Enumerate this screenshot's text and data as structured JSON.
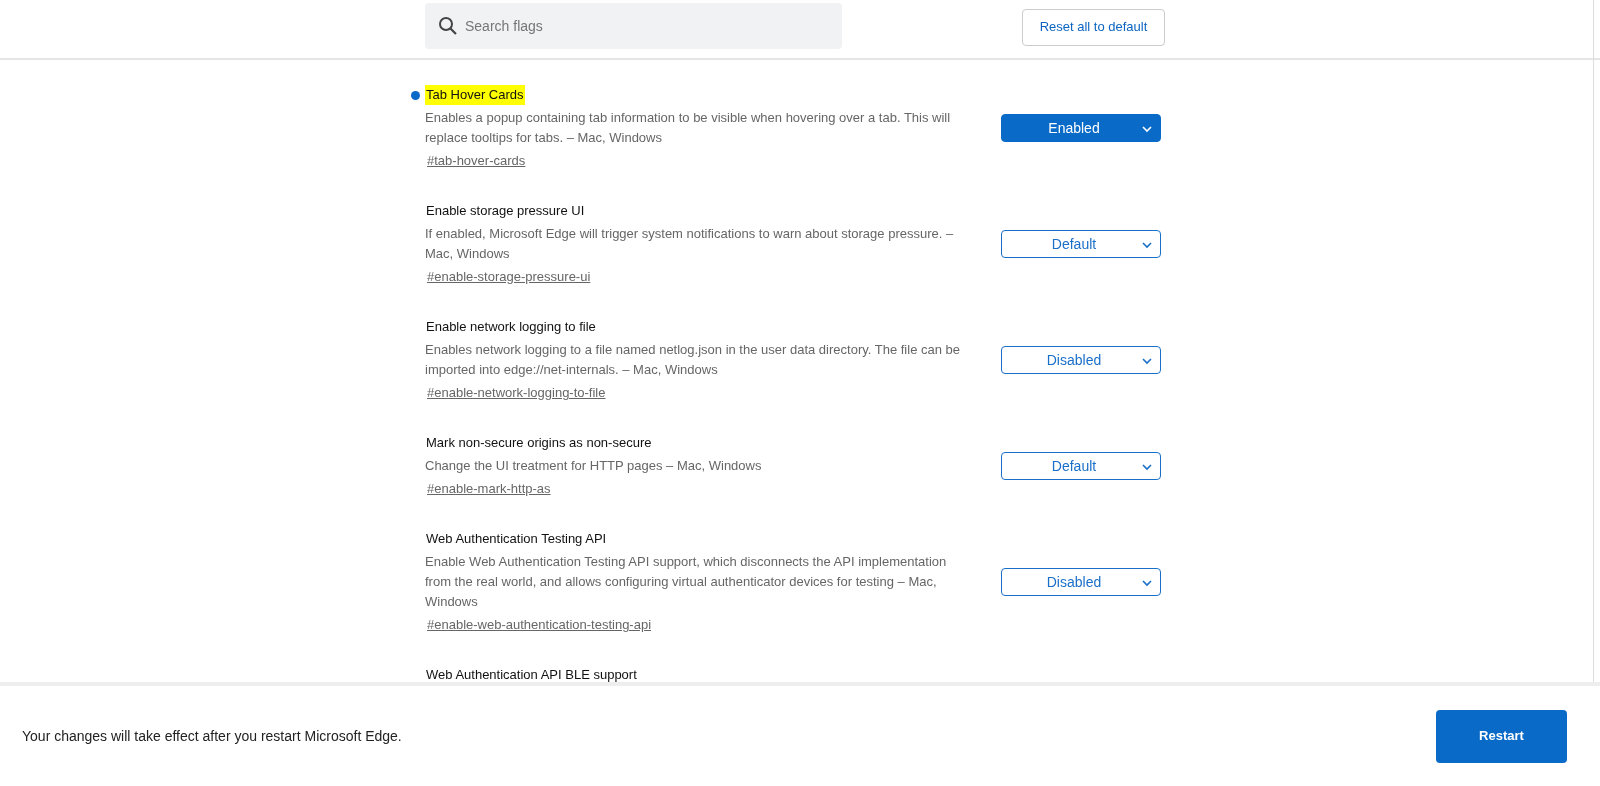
{
  "search": {
    "placeholder": "Search flags"
  },
  "reset_button": "Reset all to default",
  "flags": [
    {
      "title": "Tab Hover Cards",
      "highlighted": true,
      "modified": true,
      "description": "Enables a popup containing tab information to be visible when hovering over a tab. This will replace tooltips for tabs. – Mac, Windows",
      "link": "#tab-hover-cards",
      "value": "Enabled"
    },
    {
      "title": "Enable storage pressure UI",
      "highlighted": false,
      "modified": false,
      "description": "If enabled, Microsoft Edge will trigger system notifications to warn about storage pressure. – Mac, Windows",
      "link": "#enable-storage-pressure-ui",
      "value": "Default"
    },
    {
      "title": "Enable network logging to file",
      "highlighted": false,
      "modified": false,
      "description": "Enables network logging to a file named netlog.json in the user data directory. The file can be imported into edge://net-internals. – Mac, Windows",
      "link": "#enable-network-logging-to-file",
      "value": "Disabled"
    },
    {
      "title": "Mark non-secure origins as non-secure",
      "highlighted": false,
      "modified": false,
      "description": "Change the UI treatment for HTTP pages – Mac, Windows",
      "link": "#enable-mark-http-as",
      "value": "Default"
    },
    {
      "title": "Web Authentication Testing API",
      "highlighted": false,
      "modified": false,
      "description": "Enable Web Authentication Testing API support, which disconnects the API implementation from the real world, and allows configuring virtual authenticator devices for testing – Mac, Windows",
      "link": "#enable-web-authentication-testing-api",
      "value": "Disabled"
    },
    {
      "title": "Web Authentication API BLE support",
      "highlighted": false,
      "modified": false
    }
  ],
  "footer": {
    "message": "Your changes will take effect after you restart Microsoft Edge.",
    "button": "Restart"
  }
}
